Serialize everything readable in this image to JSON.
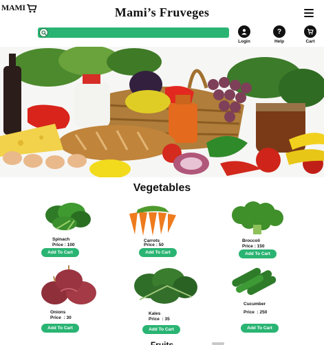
{
  "header": {
    "logo_text": "MAMI",
    "title": "Mami’s Fruveges",
    "icons": [
      "cart-logo-icon",
      "menu-icon",
      "search-icon",
      "user-icon",
      "help-icon",
      "cart-icon"
    ]
  },
  "search": {
    "placeholder": "",
    "value": ""
  },
  "nav": {
    "login": "Login",
    "help": "Help",
    "help_symbol": "?",
    "cart": "Cart"
  },
  "section": {
    "title": "Vegetables",
    "next_title": "Fruits"
  },
  "products": [
    {
      "name": "Spinach",
      "price": "Price : 100",
      "button": "Add To Cart"
    },
    {
      "name": "Carrots",
      "price": "Price : 50",
      "button": "Add To Cart"
    },
    {
      "name": "Broccoli",
      "price": "Price : 150",
      "button": "Add To Cart"
    },
    {
      "name": "Onions",
      "price": "Price  : 30",
      "button": "Add To Cart"
    },
    {
      "name": "Kales",
      "price": "Price  : 35",
      "button": "Add To Cart"
    },
    {
      "name": "Cucumber",
      "price": "Price  : 250",
      "button": "Add To Cart"
    }
  ],
  "colors": {
    "accent": "#2ab473",
    "text": "#111111",
    "background": "#ffffff"
  }
}
